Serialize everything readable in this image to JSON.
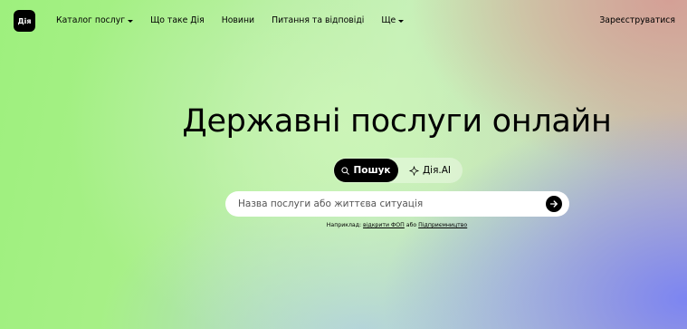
{
  "header": {
    "logo_text": "Дія",
    "nav": [
      {
        "label": "Каталог послуг",
        "has_dropdown": true
      },
      {
        "label": "Що таке Дія",
        "has_dropdown": false
      },
      {
        "label": "Новини",
        "has_dropdown": false
      },
      {
        "label": "Питання та відповіді",
        "has_dropdown": false
      },
      {
        "label": "Ще",
        "has_dropdown": true
      }
    ],
    "register_label": "Зареєструватися"
  },
  "hero": {
    "title": "Державні послуги онлайн",
    "toggle": {
      "search_label": "Пошук",
      "ai_label": "Дія.AI",
      "active": "search"
    },
    "search": {
      "placeholder": "Назва послуги або життєва ситуація",
      "value": ""
    },
    "hint": {
      "prefix": "Наприклад:",
      "link1": "відкрити ФОП",
      "connector": "або",
      "link2": "Підприємництво"
    }
  },
  "icons": {
    "search_toggle": "search-icon",
    "ai_toggle": "sparkle-icon",
    "submit": "arrow-right-icon",
    "dropdown": "caret-down-icon"
  },
  "colors": {
    "primary": "#000000",
    "background_green": "#9ef07e",
    "background_violet": "#7f8cf3",
    "background_rose": "#d4a096"
  }
}
